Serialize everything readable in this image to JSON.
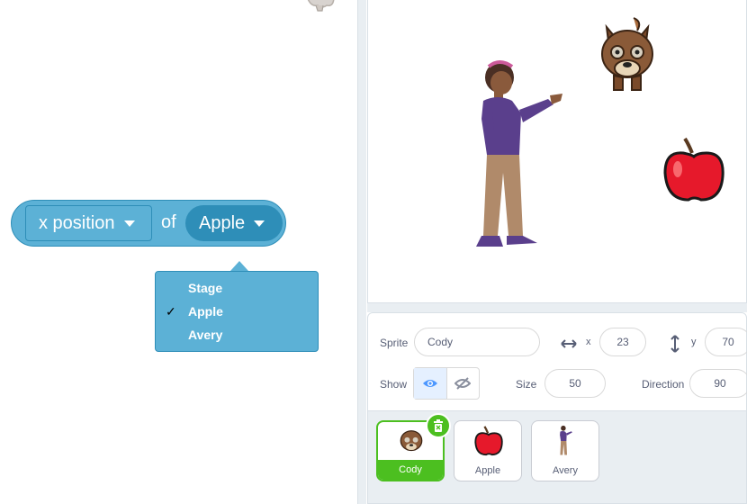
{
  "block": {
    "property": "x position",
    "of_text": "of",
    "target": "Apple"
  },
  "menu": {
    "items": [
      {
        "label": "Stage",
        "checked": false
      },
      {
        "label": "Apple",
        "checked": true
      },
      {
        "label": "Avery",
        "checked": false
      }
    ],
    "check_mark": "✓"
  },
  "sprite_info": {
    "sprite_label": "Sprite",
    "sprite_name": "Cody",
    "x_label": "x",
    "x_value": "23",
    "y_label": "y",
    "y_value": "70",
    "show_label": "Show",
    "size_label": "Size",
    "size_value": "50",
    "direction_label": "Direction",
    "direction_value": "90"
  },
  "sprites": [
    {
      "name": "Cody",
      "selected": true
    },
    {
      "name": "Apple",
      "selected": false
    },
    {
      "name": "Avery",
      "selected": false
    }
  ],
  "colors": {
    "block_blue": "#5cb1d6",
    "block_dark": "#2e8eb8",
    "selected_green": "#4cbf20",
    "visible_eye": "#4c97ff"
  }
}
